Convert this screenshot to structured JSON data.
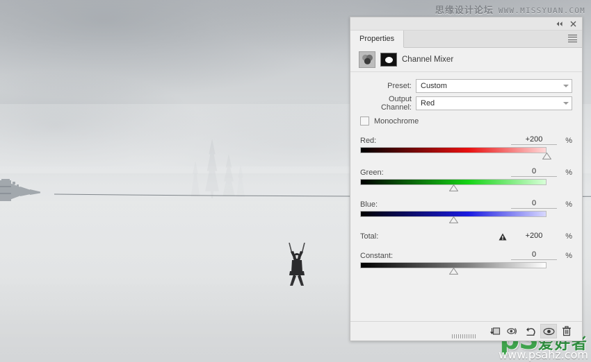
{
  "photo": {
    "description": "Foggy mountain valley with faint conifers, a zipline tower at left and a person riding the zipline",
    "subject": "zipline-rider",
    "landmark": "zipline-tower"
  },
  "watermarks": {
    "top": {
      "forum": "思缘设计论坛",
      "url": "WWW.MISSYUAN.COM"
    },
    "bottom": {
      "brand": "pS",
      "cn": "爱好者",
      "url": "www.psahz.com"
    }
  },
  "panel": {
    "collapse_icon": "collapse-double-chevron-icon",
    "close_icon": "close-icon",
    "tab_label": "Properties",
    "menu_icon": "panel-menu-icon",
    "adjustment": {
      "icon": "channel-mixer-icon",
      "mask_thumb": "layer-mask-thumbnail",
      "title": "Channel Mixer"
    },
    "preset": {
      "label": "Preset:",
      "value": "Custom"
    },
    "output_channel": {
      "label": "Output Channel:",
      "value": "Red"
    },
    "monochrome": {
      "label": "Monochrome",
      "checked": false
    },
    "sliders": [
      {
        "name": "red",
        "label": "Red:",
        "value": "+200",
        "unit": "%",
        "position": 100,
        "from": "#000000",
        "mid": "#e81010",
        "to": "#ffd8d8"
      },
      {
        "name": "green",
        "label": "Green:",
        "value": "0",
        "unit": "%",
        "position": 50,
        "from": "#000000",
        "mid": "#16d316",
        "to": "#d8ffd8"
      },
      {
        "name": "blue",
        "label": "Blue:",
        "value": "0",
        "unit": "%",
        "position": 50,
        "from": "#000000",
        "mid": "#1a1ae0",
        "to": "#d8d8ff"
      },
      {
        "name": "constant",
        "label": "Constant:",
        "value": "0",
        "unit": "%",
        "position": 50,
        "from": "#000000",
        "mid": "#808080",
        "to": "#ffffff"
      }
    ],
    "total": {
      "label": "Total:",
      "value": "+200",
      "unit": "%",
      "warning_icon": "warning-triangle-icon"
    },
    "footer": [
      {
        "name": "clip-to-layer-button",
        "icon": "clip-to-layer-icon",
        "active": false
      },
      {
        "name": "view-previous-state-button",
        "icon": "eye-previous-state-icon",
        "active": false
      },
      {
        "name": "reset-button",
        "icon": "reset-arrow-icon",
        "active": false
      },
      {
        "name": "toggle-visibility-button",
        "icon": "eye-icon",
        "active": true
      },
      {
        "name": "delete-layer-button",
        "icon": "trash-icon",
        "active": false
      }
    ],
    "resize_grip": "resize-grip"
  }
}
